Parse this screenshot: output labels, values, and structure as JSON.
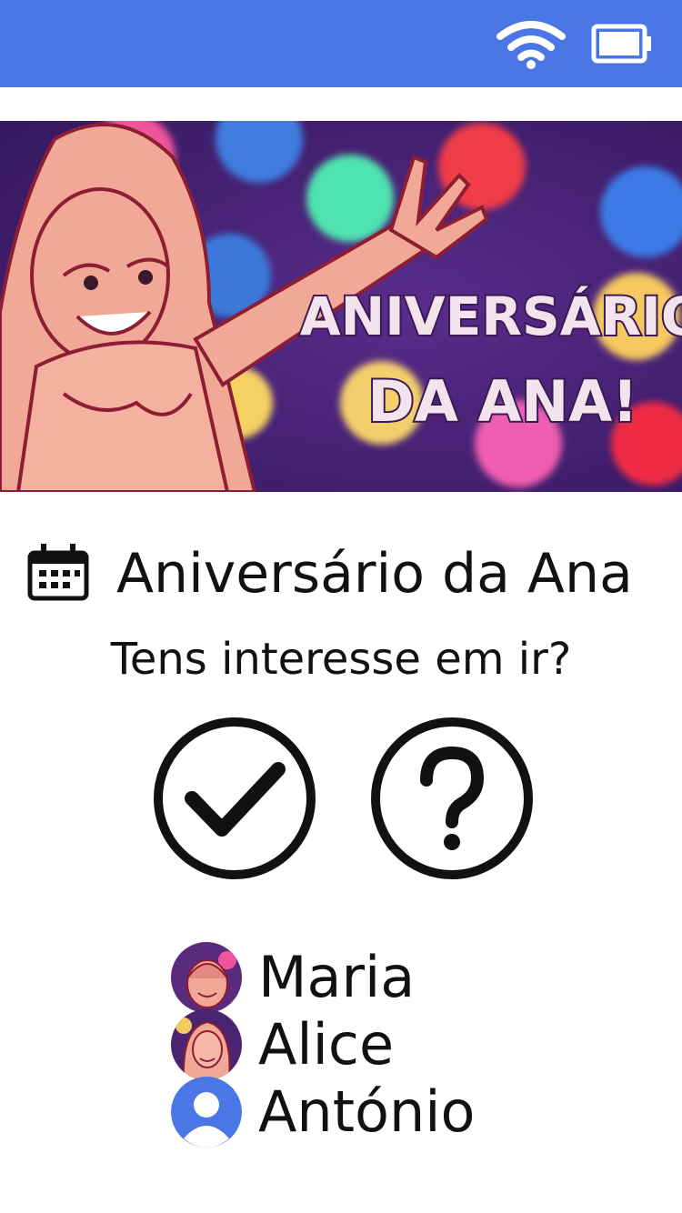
{
  "status_bar": {
    "background": "#4a77e5",
    "icons": [
      "wifi-icon",
      "battery-icon"
    ]
  },
  "banner": {
    "line1": "ANIVERSÁRIO",
    "line2": "DA ANA!",
    "text_color": "#f2e3ec",
    "outline_color": "#3a1a55"
  },
  "event": {
    "icon": "calendar-icon",
    "title": "Aniversário da Ana",
    "question": "Tens interesse em ir?"
  },
  "actions": [
    {
      "icon": "check-circle-icon"
    },
    {
      "icon": "question-circle-icon"
    }
  ],
  "attendees": [
    {
      "name": "Maria"
    },
    {
      "name": "Alice"
    },
    {
      "name": "António"
    }
  ]
}
